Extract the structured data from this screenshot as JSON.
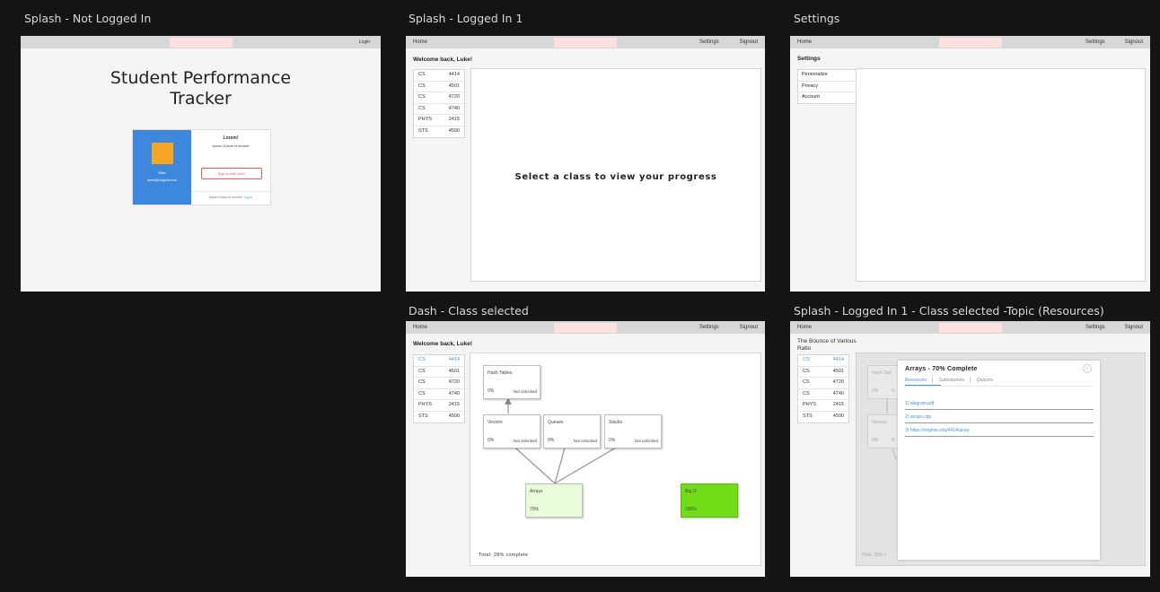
{
  "frames": {
    "splash": {
      "title": "Splash - Not Logged In",
      "login": "Login",
      "app_title_line1": "Student Performance",
      "app_title_line2": "Tracker",
      "card": {
        "name": "Mike",
        "email": "mark@virginia.edu",
        "heading": "Lorem!",
        "subheading": "Ipsum Dolum si ammet",
        "signin_button": "Sign in with Univ!",
        "footer_text": "Ipsum Dolum si ammet?",
        "footer_link": "Log in"
      }
    },
    "logged_in": {
      "title": "Splash - Logged In 1",
      "nav": {
        "home": "Home",
        "settings": "Settings",
        "signout": "Signout"
      },
      "welcome": "Welcome back, Luke!",
      "classes": [
        {
          "dept": "CS",
          "num": "4414"
        },
        {
          "dept": "CS",
          "num": "4501"
        },
        {
          "dept": "CS",
          "num": "4720"
        },
        {
          "dept": "CS",
          "num": "4740"
        },
        {
          "dept": "PHYS",
          "num": "2415"
        },
        {
          "dept": "STS",
          "num": "4500"
        }
      ],
      "prompt": "Select a class to view your progress"
    },
    "settings": {
      "title": "Settings",
      "nav": {
        "home": "Home",
        "settings": "Settings",
        "signout": "Signout"
      },
      "heading": "Settings",
      "menu": [
        "Personalize",
        "Privacy",
        "Account"
      ]
    },
    "dash": {
      "title": "Dash - Class selected",
      "nav": {
        "home": "Home",
        "settings": "Settings",
        "signout": "Signout"
      },
      "welcome": "Welcome back, Luke!",
      "classes": [
        {
          "dept": "CS",
          "num": "4414"
        },
        {
          "dept": "CS",
          "num": "4501"
        },
        {
          "dept": "CS",
          "num": "4720"
        },
        {
          "dept": "CS",
          "num": "4740"
        },
        {
          "dept": "PHYS",
          "num": "2415"
        },
        {
          "dept": "STS",
          "num": "4500"
        }
      ],
      "nodes": {
        "hash_tables": {
          "title": "Hash Tables",
          "pct": "0%",
          "status": "Not unlocked"
        },
        "vectors": {
          "title": "Vectors",
          "pct": "0%",
          "status": "Not unlocked"
        },
        "queues": {
          "title": "Queues",
          "pct": "0%",
          "status": "Not unlocked"
        },
        "stacks": {
          "title": "Stacks",
          "pct": "0%",
          "status": "Not unlocked"
        },
        "arrays": {
          "title": "Arrays",
          "pct": "70%"
        },
        "big_o": {
          "title": "Big O",
          "pct": "100%"
        }
      },
      "total": "Total: 28% complete",
      "colors": {
        "arrays_fill": "#e9fbd9",
        "big_o_fill": "#72dc18",
        "active_class": "#4a90d9"
      }
    },
    "topic": {
      "title": "Splash - Logged In 1 - Class selected -Topic (Resources)",
      "nav": {
        "home": "Home",
        "settings": "Settings",
        "signout": "Signout"
      },
      "welcome_line1": "The Bounce of Various",
      "welcome_line2": "Ratio",
      "classes": [
        {
          "dept": "CS",
          "num": "4414"
        },
        {
          "dept": "CS",
          "num": "4501"
        },
        {
          "dept": "CS",
          "num": "4720"
        },
        {
          "dept": "CS",
          "num": "4740"
        },
        {
          "dept": "PHYS",
          "num": "2415"
        },
        {
          "dept": "STS",
          "num": "4500"
        }
      ],
      "bg_nodes": {
        "hash": "Hash Tabl",
        "vectors": "Vectors",
        "pct": "0%",
        "status": "N"
      },
      "bg_total": "Total: 28% c",
      "modal": {
        "title": "Arrays - 70% Complete",
        "close": "x",
        "tabs": [
          "Resources",
          "Submissions",
          "Quizzes"
        ],
        "resources": [
          "1) diagram.pdf",
          "2) arrays.cpp",
          "3) https://virginia.edu/4414/array"
        ]
      }
    }
  }
}
